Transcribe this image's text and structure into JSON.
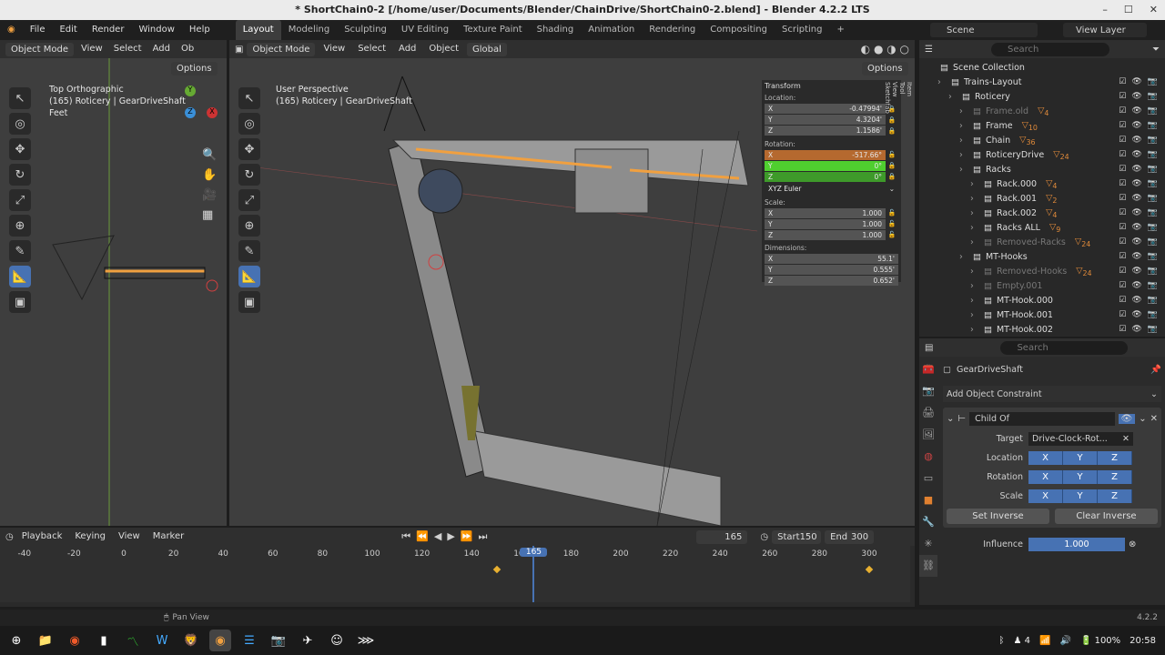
{
  "window": {
    "title": "* ShortChain0-2 [/home/user/Documents/Blender/ChainDrive/ShortChain0-2.blend] - Blender 4.2.2 LTS"
  },
  "menu": [
    "File",
    "Edit",
    "Render",
    "Window",
    "Help"
  ],
  "workspaces": [
    {
      "label": "Layout",
      "active": true
    },
    {
      "label": "Modeling"
    },
    {
      "label": "Sculpting"
    },
    {
      "label": "UV Editing"
    },
    {
      "label": "Texture Paint"
    },
    {
      "label": "Shading"
    },
    {
      "label": "Animation"
    },
    {
      "label": "Rendering"
    },
    {
      "label": "Compositing"
    },
    {
      "label": "Scripting"
    }
  ],
  "scene": "Scene",
  "view_layer": "View Layer",
  "left_viewport": {
    "mode": "Object Mode",
    "menus": [
      "View",
      "Select",
      "Add",
      "Ob"
    ],
    "options": "Options",
    "view_name": "Top Orthographic",
    "context": "(165) Roticery | GearDriveShaft",
    "units": "Feet"
  },
  "main_viewport": {
    "mode": "Object Mode",
    "menus": [
      "View",
      "Select",
      "Add",
      "Object"
    ],
    "orientation": "Global",
    "options": "Options",
    "view_name": "User Perspective",
    "context": "(165) Roticery | GearDriveShaft"
  },
  "transform": {
    "title": "Transform",
    "location_label": "Location:",
    "location": [
      "-0.47994'",
      "4.3204'",
      "1.1586'"
    ],
    "rotation_label": "Rotation:",
    "rotation": [
      "-517.66°",
      "0°",
      "0°"
    ],
    "rotation_mode": "XYZ Euler",
    "scale_label": "Scale:",
    "scale": [
      "1.000",
      "1.000",
      "1.000"
    ],
    "dimensions_label": "Dimensions:",
    "dimensions": [
      "55.1'",
      "0.555'",
      "0.652'"
    ],
    "axes": [
      "X",
      "Y",
      "Z"
    ],
    "tabs": [
      "Item",
      "Tool",
      "View",
      "Sketchfab"
    ]
  },
  "outliner": {
    "search_placeholder": "Search",
    "items": [
      {
        "name": "Scene Collection",
        "depth": 0
      },
      {
        "name": "Trains-Layout",
        "depth": 1
      },
      {
        "name": "Roticery",
        "depth": 2
      },
      {
        "name": "Frame.old",
        "depth": 3,
        "dim": true,
        "badge": "4"
      },
      {
        "name": "Frame",
        "depth": 3,
        "badge": "10"
      },
      {
        "name": "Chain",
        "depth": 3,
        "badge": "36"
      },
      {
        "name": "RoticeryDrive",
        "depth": 3,
        "badge": "24"
      },
      {
        "name": "Racks",
        "depth": 3
      },
      {
        "name": "Rack.000",
        "depth": 4,
        "badge": "4"
      },
      {
        "name": "Rack.001",
        "depth": 4,
        "badge": "2"
      },
      {
        "name": "Rack.002",
        "depth": 4,
        "badge": "4"
      },
      {
        "name": "Racks ALL",
        "depth": 4,
        "badge": "9"
      },
      {
        "name": "Removed-Racks",
        "depth": 4,
        "dim": true,
        "badge": "24"
      },
      {
        "name": "MT-Hooks",
        "depth": 3
      },
      {
        "name": "Removed-Hooks",
        "depth": 4,
        "dim": true,
        "badge": "24"
      },
      {
        "name": "Empty.001",
        "depth": 4,
        "dim": true
      },
      {
        "name": "MT-Hook.000",
        "depth": 4
      },
      {
        "name": "MT-Hook.001",
        "depth": 4
      },
      {
        "name": "MT-Hook.002",
        "depth": 4
      }
    ]
  },
  "properties": {
    "search_placeholder": "Search",
    "object": "GearDriveShaft",
    "add_constraint": "Add Object Constraint",
    "constraint": {
      "name": "Child Of",
      "target_label": "Target",
      "target": "Drive-Clock-Rot...",
      "location_label": "Location",
      "rotation_label": "Rotation",
      "scale_label": "Scale",
      "axes": [
        "X",
        "Y",
        "Z"
      ],
      "set_inverse": "Set Inverse",
      "clear_inverse": "Clear Inverse",
      "influence_label": "Influence",
      "influence": "1.000"
    }
  },
  "timeline": {
    "menus": [
      "Playback",
      "Keying",
      "View",
      "Marker"
    ],
    "current_frame": "165",
    "start_label": "Start",
    "start": "150",
    "end_label": "End",
    "end": "300",
    "ticks": [
      "-40",
      "-20",
      "0",
      "20",
      "40",
      "60",
      "80",
      "100",
      "120",
      "140",
      "160",
      "180",
      "200",
      "220",
      "240",
      "260",
      "280",
      "300"
    ],
    "keyframes": [
      150,
      300
    ]
  },
  "status": {
    "hint": "Pan View",
    "version": "4.2.2"
  },
  "taskbar": {
    "workspace": "4",
    "battery": "100%",
    "clock": "20:58"
  },
  "colors": {
    "accent": "#4772b3",
    "rotation_x": "#b5692f",
    "rotation_y": "#4fcf2f",
    "selected": "#f0a040"
  }
}
